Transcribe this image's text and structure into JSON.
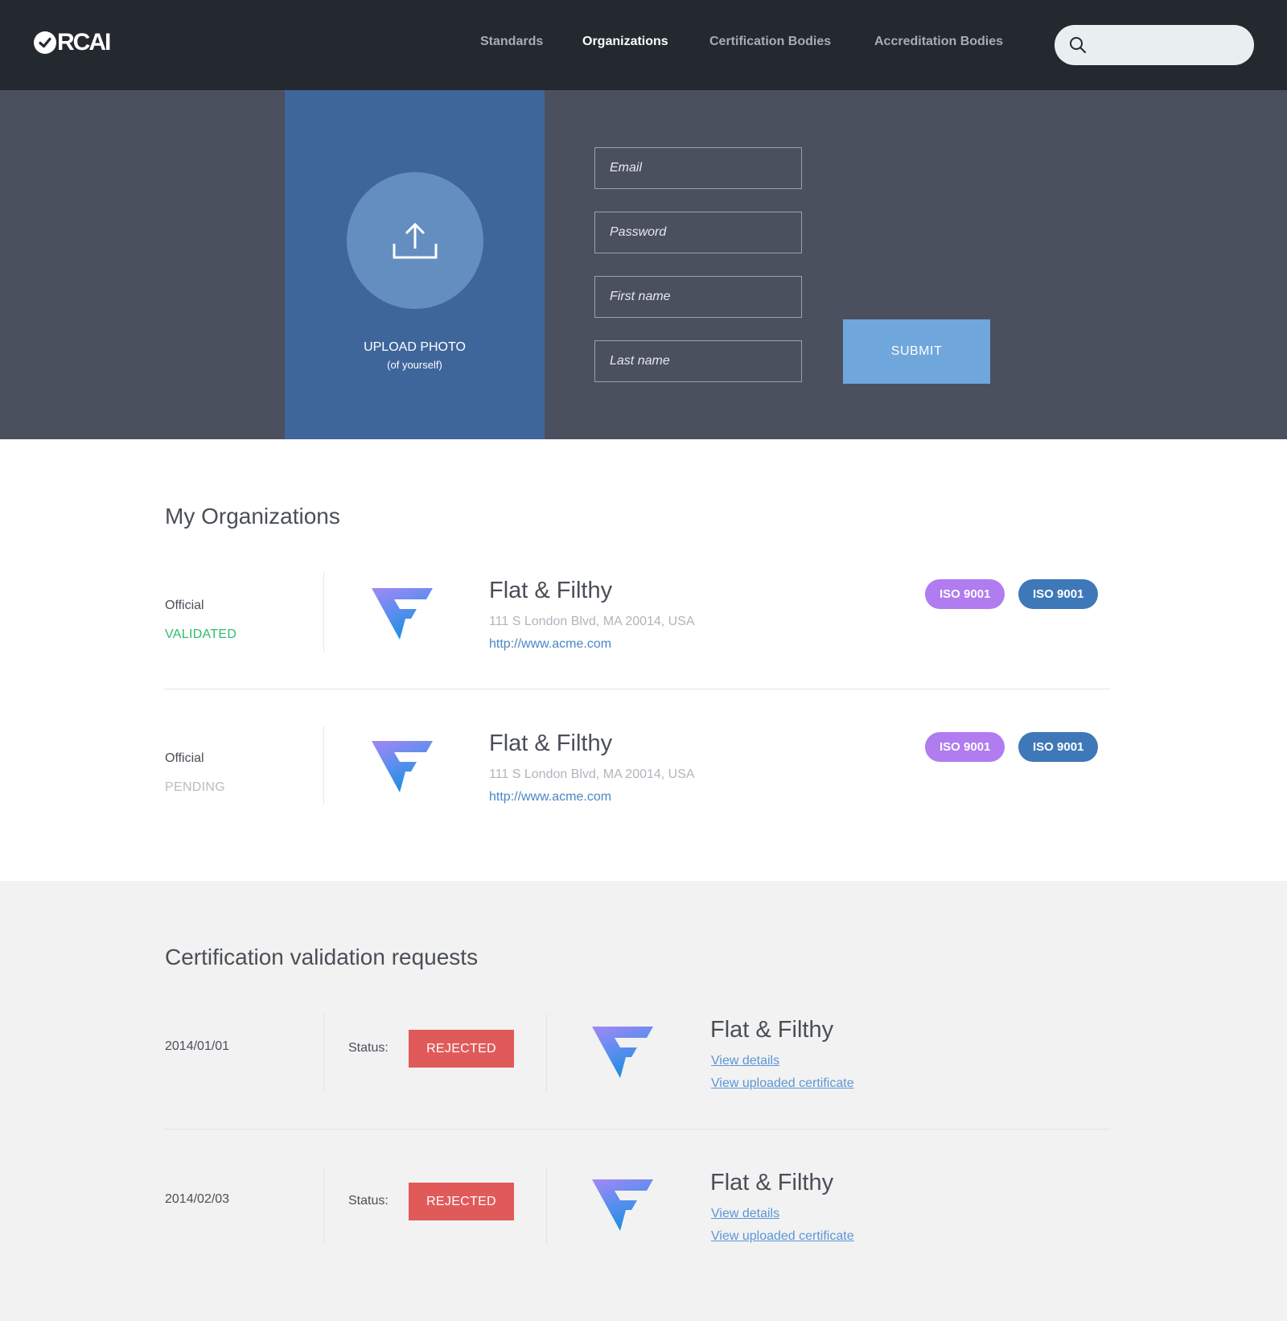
{
  "nav": {
    "logo_text": "RCAI",
    "links": [
      "Standards",
      "Organizations",
      "Certification Bodies",
      "Accreditation Bodies"
    ],
    "active_link": "Organizations",
    "search_placeholder": ""
  },
  "profile_form": {
    "upload_title": "UPLOAD PHOTO",
    "upload_subtitle": "(of yourself)",
    "email_placeholder": "Email",
    "password_placeholder": "Password",
    "first_name_placeholder": "First name",
    "last_name_placeholder": "Last name",
    "submit_label": "SUBMIT"
  },
  "my_organizations": {
    "title": "My Organizations",
    "items": [
      {
        "type": "Official",
        "status": "VALIDATED",
        "name": "Flat & Filthy",
        "address": "111 S London Blvd, MA 20014, USA",
        "url": "http://www.acme.com",
        "tags": [
          "ISO 9001",
          "ISO 9001"
        ]
      },
      {
        "type": "Official",
        "status": "PENDING",
        "name": "Flat & Filthy",
        "address": "111 S London Blvd, MA 20014, USA",
        "url": "http://www.acme.com",
        "tags": [
          "ISO 9001",
          "ISO 9001"
        ]
      }
    ]
  },
  "certification_requests": {
    "title": "Certification validation requests",
    "status_label": "Status:",
    "items": [
      {
        "date": "2014/01/01",
        "status": "REJECTED",
        "name": "Flat & Filthy",
        "view_details": "View details",
        "view_certificate": "View uploaded certificate"
      },
      {
        "date": "2014/02/03",
        "status": "REJECTED",
        "name": "Flat & Filthy",
        "view_details": "View details",
        "view_certificate": "View uploaded certificate"
      }
    ]
  },
  "colors": {
    "nav_bg": "#23292e",
    "hero_bg": "#4a505e",
    "upload_panel": "#3f669b",
    "submit": "#6fa6dc",
    "validated": "#2dbd6e",
    "pending": "#b7bcc3",
    "tag_purple": "#b07cf0",
    "tag_blue": "#3f78b8",
    "rejected": "#e05a5a",
    "link": "#4a86c8"
  },
  "icons": [
    "check-circle-icon",
    "search-icon",
    "upload-icon",
    "org-logo-icon"
  ]
}
